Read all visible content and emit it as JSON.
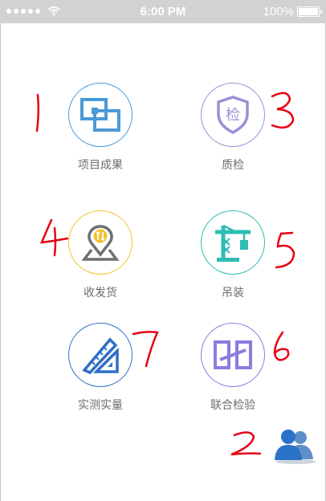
{
  "status_bar": {
    "time": "6:00 PM",
    "battery": "100%"
  },
  "menu": {
    "items": [
      {
        "label": "项目成果",
        "icon": "project-results-icon",
        "color": "#4a9ad8"
      },
      {
        "label": "质检",
        "icon": "quality-shield-icon",
        "color": "#9b8fd6"
      },
      {
        "label": "收发货",
        "icon": "location-transfer-icon",
        "color": "#f2c230"
      },
      {
        "label": "吊装",
        "icon": "crane-icon",
        "color": "#2fbcb5"
      },
      {
        "label": "实测实量",
        "icon": "ruler-triangle-icon",
        "color": "#2f6fc8"
      },
      {
        "label": "联合检验",
        "icon": "joint-inspection-icon",
        "color": "#8a7de0"
      }
    ]
  },
  "quality_icon_char": "检",
  "contacts": {
    "icon": "contacts-icon",
    "color": "#2a72c8"
  },
  "annotations": [
    "1",
    "2",
    "3",
    "4",
    "5",
    "6",
    "7"
  ]
}
